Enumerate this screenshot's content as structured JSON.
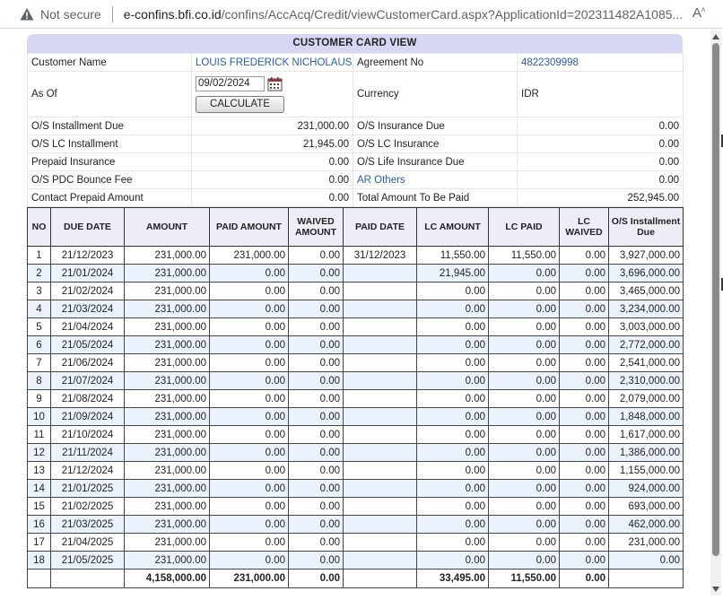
{
  "browser": {
    "not_secure": "Not secure",
    "url_host": "e-confins.bfi.co.id",
    "url_path": "/confins/AccAcq/Credit/viewCustomerCard.aspx?ApplicationId=202311482A1085..."
  },
  "card": {
    "title": "CUSTOMER CARD VIEW",
    "customer_name_label": "Customer Name",
    "customer_name": "LOUIS FREDERICK NICHOLAUS",
    "agreement_no_label": "Agreement No",
    "agreement_no": "4822309998",
    "as_of_label": "As Of",
    "as_of_value": "09/02/2024",
    "calculate_label": "CALCULATE",
    "currency_label": "Currency",
    "currency": "IDR",
    "rows": [
      {
        "l1": "O/S Installment Due",
        "v1": "231,000.00",
        "l2": "O/S Insurance Due",
        "v2": "0.00"
      },
      {
        "l1": "O/S LC Installment",
        "v1": "21,945.00",
        "l2": "O/S LC Insurance",
        "v2": "0.00"
      },
      {
        "l1": "Prepaid Insurance",
        "v1": "0.00",
        "l2": "O/S Life Insurance Due",
        "v2": "0.00"
      },
      {
        "l1": "O/S PDC Bounce Fee",
        "v1": "0.00",
        "l2": "AR Others",
        "v2": "0.00"
      },
      {
        "l1": "Contact Prepaid Amount",
        "v1": "0.00",
        "l2": "Total Amount To Be Paid",
        "v2": "252,945.00"
      }
    ]
  },
  "schedule": {
    "headers": [
      "NO",
      "DUE DATE",
      "AMOUNT",
      "PAID AMOUNT",
      "WAIVED AMOUNT",
      "PAID DATE",
      "LC AMOUNT",
      "LC PAID",
      "LC WAIVED",
      "O/S Installment Due"
    ],
    "rows": [
      [
        "1",
        "21/12/2023",
        "231,000.00",
        "231,000.00",
        "0.00",
        "31/12/2023",
        "11,550.00",
        "11,550.00",
        "0.00",
        "3,927,000.00"
      ],
      [
        "2",
        "21/01/2024",
        "231,000.00",
        "0.00",
        "0.00",
        "",
        "21,945.00",
        "0.00",
        "0.00",
        "3,696,000.00"
      ],
      [
        "3",
        "21/02/2024",
        "231,000.00",
        "0.00",
        "0.00",
        "",
        "0.00",
        "0.00",
        "0.00",
        "3,465,000.00"
      ],
      [
        "4",
        "21/03/2024",
        "231,000.00",
        "0.00",
        "0.00",
        "",
        "0.00",
        "0.00",
        "0.00",
        "3,234,000.00"
      ],
      [
        "5",
        "21/04/2024",
        "231,000.00",
        "0.00",
        "0.00",
        "",
        "0.00",
        "0.00",
        "0.00",
        "3,003,000.00"
      ],
      [
        "6",
        "21/05/2024",
        "231,000.00",
        "0.00",
        "0.00",
        "",
        "0.00",
        "0.00",
        "0.00",
        "2,772,000.00"
      ],
      [
        "7",
        "21/06/2024",
        "231,000.00",
        "0.00",
        "0.00",
        "",
        "0.00",
        "0.00",
        "0.00",
        "2,541,000.00"
      ],
      [
        "8",
        "21/07/2024",
        "231,000.00",
        "0.00",
        "0.00",
        "",
        "0.00",
        "0.00",
        "0.00",
        "2,310,000.00"
      ],
      [
        "9",
        "21/08/2024",
        "231,000.00",
        "0.00",
        "0.00",
        "",
        "0.00",
        "0.00",
        "0.00",
        "2,079,000.00"
      ],
      [
        "10",
        "21/09/2024",
        "231,000.00",
        "0.00",
        "0.00",
        "",
        "0.00",
        "0.00",
        "0.00",
        "1,848,000.00"
      ],
      [
        "11",
        "21/10/2024",
        "231,000.00",
        "0.00",
        "0.00",
        "",
        "0.00",
        "0.00",
        "0.00",
        "1,617,000.00"
      ],
      [
        "12",
        "21/11/2024",
        "231,000.00",
        "0.00",
        "0.00",
        "",
        "0.00",
        "0.00",
        "0.00",
        "1,386,000.00"
      ],
      [
        "13",
        "21/12/2024",
        "231,000.00",
        "0.00",
        "0.00",
        "",
        "0.00",
        "0.00",
        "0.00",
        "1,155,000.00"
      ],
      [
        "14",
        "21/01/2025",
        "231,000.00",
        "0.00",
        "0.00",
        "",
        "0.00",
        "0.00",
        "0.00",
        "924,000.00"
      ],
      [
        "15",
        "21/02/2025",
        "231,000.00",
        "0.00",
        "0.00",
        "",
        "0.00",
        "0.00",
        "0.00",
        "693,000.00"
      ],
      [
        "16",
        "21/03/2025",
        "231,000.00",
        "0.00",
        "0.00",
        "",
        "0.00",
        "0.00",
        "0.00",
        "462,000.00"
      ],
      [
        "17",
        "21/04/2025",
        "231,000.00",
        "0.00",
        "0.00",
        "",
        "0.00",
        "0.00",
        "0.00",
        "231,000.00"
      ],
      [
        "18",
        "21/05/2025",
        "231,000.00",
        "0.00",
        "0.00",
        "",
        "0.00",
        "0.00",
        "0.00",
        "0.00"
      ]
    ],
    "totals": [
      "",
      "",
      "4,158,000.00",
      "231,000.00",
      "0.00",
      "",
      "33,495.00",
      "11,550.00",
      "0.00",
      ""
    ]
  },
  "colors": {
    "title_bg": "#d6d6f5",
    "link_blue": "#2a5db0",
    "row_alt": "#eaf3fb"
  }
}
